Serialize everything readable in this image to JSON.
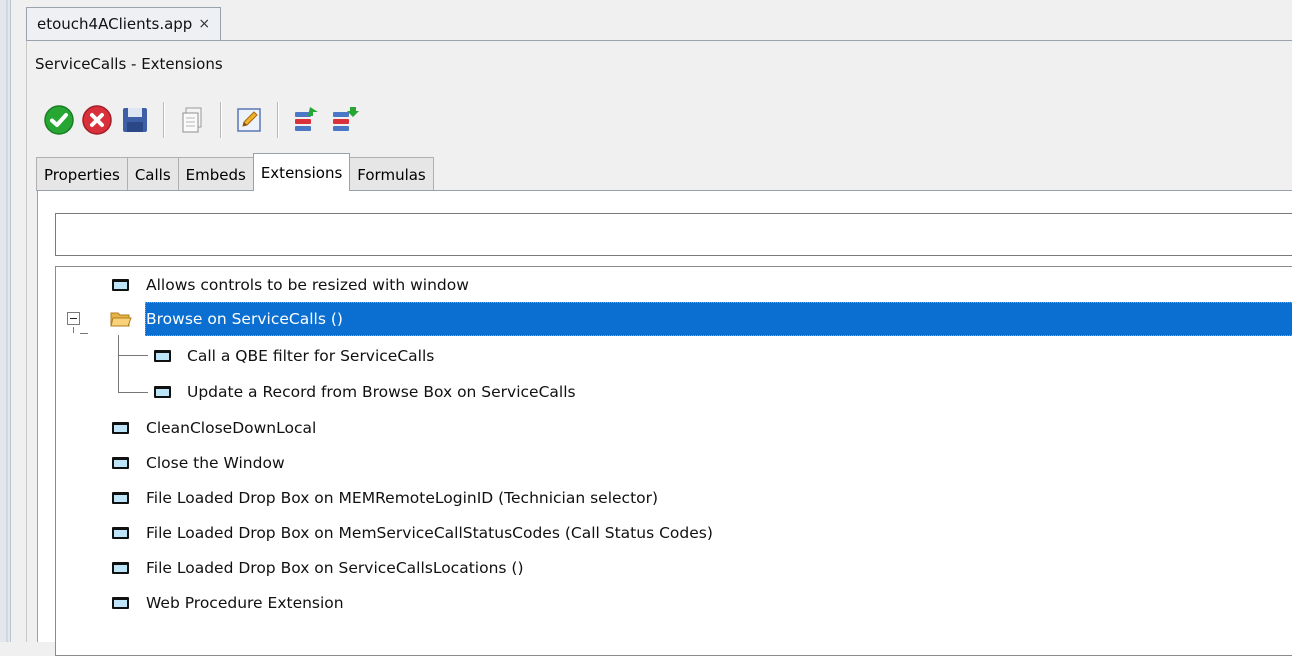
{
  "editor_tab": {
    "title": "etouch4AClients.app",
    "close_glyph": "×"
  },
  "window": {
    "title": "ServiceCalls - Extensions"
  },
  "toolbar": {
    "buttons": [
      {
        "icon": "ok-check-icon"
      },
      {
        "icon": "cancel-x-icon"
      },
      {
        "icon": "save-disk-icon"
      },
      {
        "icon": "copy-document-icon"
      },
      {
        "icon": "edit-pencil-icon"
      },
      {
        "icon": "move-up-list-icon"
      },
      {
        "icon": "move-down-list-icon"
      }
    ]
  },
  "tabs": [
    {
      "label": "Properties"
    },
    {
      "label": "Calls"
    },
    {
      "label": "Embeds"
    },
    {
      "label": "Extensions",
      "active": true
    },
    {
      "label": "Formulas"
    }
  ],
  "filter": {
    "value": "",
    "placeholder": ""
  },
  "tree": {
    "items": [
      {
        "label": "Allows controls to be resized with window"
      },
      {
        "label": "Browse on ServiceCalls ()",
        "selected": true
      },
      {
        "label": "Call a QBE filter for ServiceCalls"
      },
      {
        "label": "Update a Record from Browse Box on ServiceCalls"
      },
      {
        "label": "CleanCloseDownLocal"
      },
      {
        "label": "Close the Window"
      },
      {
        "label": "File Loaded Drop Box on MEMRemoteLoginID (Technician selector)"
      },
      {
        "label": "File Loaded Drop Box on MemServiceCallStatusCodes (Call Status Codes)"
      },
      {
        "label": "File Loaded Drop Box on ServiceCallsLocations ()"
      },
      {
        "label": "Web Procedure Extension"
      }
    ]
  },
  "colors": {
    "selection": "#0a6fd1",
    "accent_green": "#27a634",
    "accent_red": "#d9313b"
  }
}
